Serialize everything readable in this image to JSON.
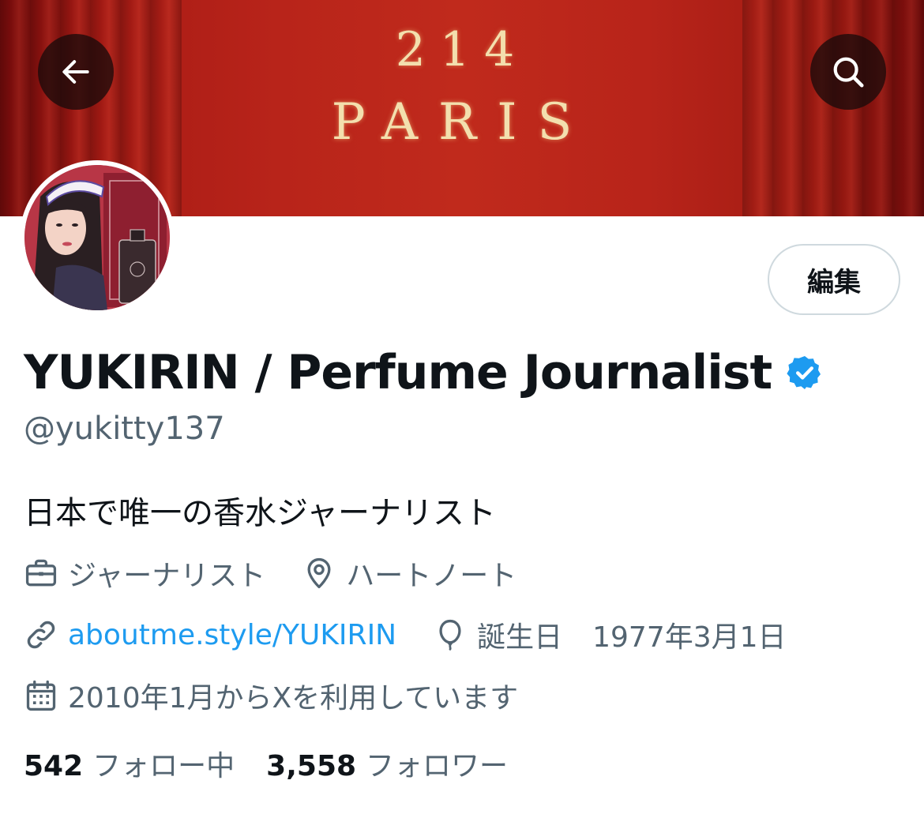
{
  "banner": {
    "line1": "214",
    "line2": "PARIS"
  },
  "header": {
    "back_icon": "arrow-left-icon",
    "search_icon": "search-icon"
  },
  "profile": {
    "display_name": "YUKIRIN / Perfume Journalist",
    "verified_icon": "verified-badge-icon",
    "handle": "@yukitty137",
    "edit_label": "編集",
    "bio": "日本で唯一の香水ジャーナリスト"
  },
  "meta": {
    "profession": "ジャーナリスト",
    "location": "ハートノート",
    "website": "aboutme.style/YUKIRIN",
    "birthday_label": "誕生日",
    "birthday_value": "1977年3月1日",
    "joined": "2010年1月からXを利用しています"
  },
  "stats": {
    "following_count": "542",
    "following_label": "フォロー中",
    "followers_count": "3,558",
    "followers_label": "フォロワー"
  },
  "colors": {
    "accent": "#1d9bf0",
    "banner_red": "#b8241a",
    "secondary_text": "#536471",
    "primary_text": "#0f1419"
  }
}
